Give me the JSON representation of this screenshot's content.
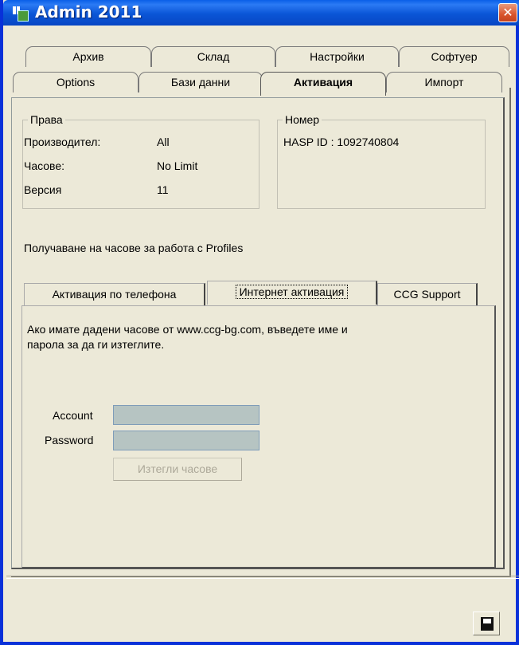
{
  "window": {
    "title": "Admin 2011",
    "close_symbol": "✕"
  },
  "tabs_row1": [
    "Архив",
    "Склад",
    "Настройки",
    "Софтуер"
  ],
  "tabs_row2": [
    "Options",
    "Бази данни",
    "Активация",
    "Импорт"
  ],
  "selected_tab": "Активация",
  "rights_group": {
    "legend": "Права",
    "rows": [
      {
        "label": "Производител:",
        "value": "All"
      },
      {
        "label": "Часове:",
        "value": "No Limit"
      },
      {
        "label": "Версия",
        "value": "11"
      }
    ]
  },
  "number_group": {
    "legend": "Номер",
    "hasp_id": "HASP ID : 1092740804"
  },
  "hours_info": "Получаване на часове за работа с Profiles",
  "subtabs": [
    "Активация по телефона",
    "Интернет активация",
    "CCG Support"
  ],
  "selected_subtab": "Интернет активация",
  "internet_activation": {
    "description_line1": "Ако имате дадени часове от www.ccg-bg.com, въведете име и",
    "description_line2": "парола за да ги изтеглите.",
    "account_label": "Account",
    "account_value": "",
    "password_label": "Password",
    "password_value": "",
    "download_button": "Изтегли часове"
  },
  "icons": {
    "app": "app-icon",
    "save": "floppy-disk-icon"
  },
  "colors": {
    "titlebar": "#0A55D6",
    "close": "#D9542B",
    "input_disabled": "#B6C4C2",
    "face": "#ECE9D8"
  }
}
